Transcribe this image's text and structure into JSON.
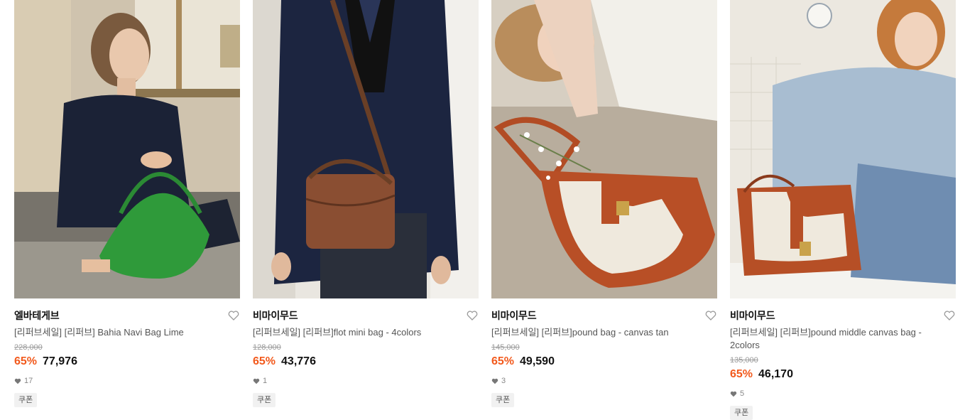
{
  "products": [
    {
      "brand": "엘바테게브",
      "title": "[리퍼브세일] [리퍼브] Bahia Navi Bag Lime",
      "original_price": "228,000",
      "discount": "65%",
      "price": "77,976",
      "likes": "17",
      "badge": "쿠폰",
      "image_alt": "model holding green shoulder bag"
    },
    {
      "brand": "비마이무드",
      "title": "[리퍼브세일] [리퍼브]flot mini bag - 4colors",
      "original_price": "128,000",
      "discount": "65%",
      "price": "43,776",
      "likes": "1",
      "badge": "쿠폰",
      "image_alt": "model with brown snake-pattern mini bag"
    },
    {
      "brand": "비마이무드",
      "title": "[리퍼브세일] [리퍼브]pound bag - canvas tan",
      "original_price": "145,000",
      "discount": "65%",
      "price": "49,590",
      "likes": "3",
      "badge": "쿠폰",
      "image_alt": "canvas and tan leather shoulder bag"
    },
    {
      "brand": "비마이무드",
      "title": "[리퍼브세일] [리퍼브]pound middle canvas bag - 2colors",
      "original_price": "135,000",
      "discount": "65%",
      "price": "46,170",
      "likes": "5",
      "badge": "쿠폰",
      "image_alt": "model with canvas middle bag"
    }
  ],
  "colors": {
    "discount": "#f25a1d",
    "price": "#111111",
    "muted": "#9a9a9a"
  },
  "icons": {
    "wishlist": "heart-outline-icon",
    "likes": "heart-filled-icon"
  }
}
